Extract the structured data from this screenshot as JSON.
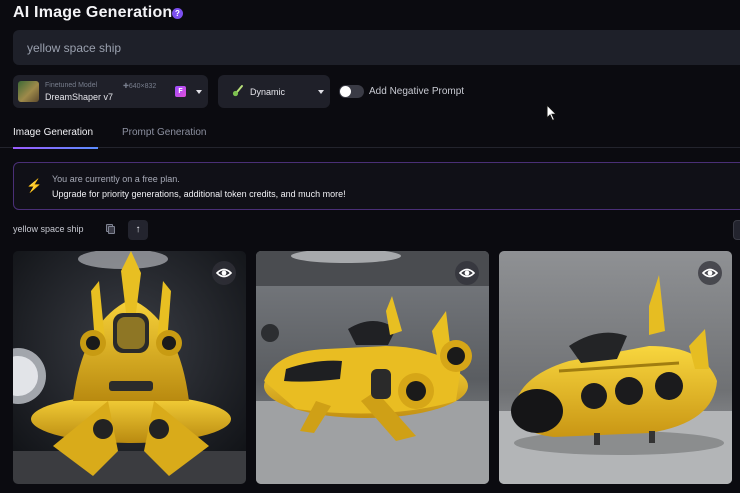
{
  "header": {
    "title": "AI Image Generation",
    "help_icon": "?"
  },
  "prompt": {
    "value": "yellow space ship"
  },
  "model": {
    "caption": "Finetuned Model",
    "dimensions": "✚640×832",
    "name": "DreamShaper v7",
    "badge": "F"
  },
  "style": {
    "label": "Dynamic"
  },
  "negative_prompt": {
    "label": "Add Negative Prompt",
    "enabled": false
  },
  "tabs": [
    {
      "label": "Image Generation",
      "active": true
    },
    {
      "label": "Prompt Generation",
      "active": false
    }
  ],
  "banner": {
    "line1": "You are currently on a free plan.",
    "line2": "Upgrade for priority generations, additional token credits, and much more!"
  },
  "results": {
    "prompt_label": "yellow space ship",
    "up_icon": "↑",
    "images": [
      {
        "name": "generated-image-1"
      },
      {
        "name": "generated-image-2"
      },
      {
        "name": "generated-image-3"
      }
    ]
  },
  "colors": {
    "accent": "#7c4ff0",
    "background": "#0b0b10",
    "panel": "#1f2029",
    "ship": "#f2c62e"
  }
}
